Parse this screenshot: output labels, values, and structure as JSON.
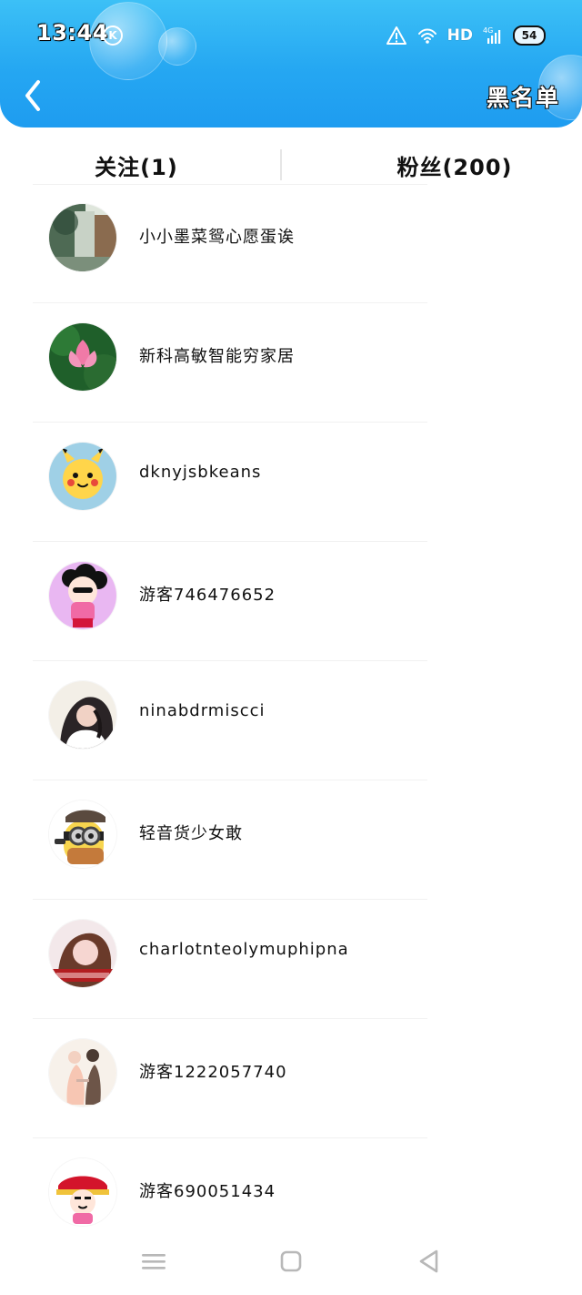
{
  "status_bar": {
    "time": "13:44",
    "carrier_icon": "k-icon",
    "right_icons": [
      "alert-icon",
      "wifi-icon",
      "hd-label",
      "signal-icon",
      "battery-pill"
    ],
    "hd": "HD",
    "battery": "54"
  },
  "header": {
    "back_icon": "chevron-left-icon",
    "blacklist_label": "黑名单"
  },
  "tabs": {
    "follow_label": "关注(1)",
    "fans_label": "粉丝(200)"
  },
  "list": {
    "items": [
      {
        "name": "小小墨菜鸳心愿蛋诶",
        "avatar_icon": "avatar-landscape"
      },
      {
        "name": "新科高敏智能穷家居",
        "avatar_icon": "avatar-lotus"
      },
      {
        "name": "dknyjsbkeans",
        "avatar_icon": "avatar-pikachu"
      },
      {
        "name": "游客746476652",
        "avatar_icon": "avatar-cartoon-girl"
      },
      {
        "name": "ninabdrmiscci",
        "avatar_icon": "avatar-portrait"
      },
      {
        "name": "轻音货少女敢",
        "avatar_icon": "avatar-minion"
      },
      {
        "name": "charlotnteolymuphipna",
        "avatar_icon": "avatar-girl-banner"
      },
      {
        "name": "游客1222057740",
        "avatar_icon": "avatar-couple"
      },
      {
        "name": "游客690051434",
        "avatar_icon": "avatar-cartoon-hat"
      }
    ]
  },
  "bottom_nav": {
    "menu_icon": "menu-icon",
    "home_icon": "square-icon",
    "back_icon": "triangle-back-icon"
  },
  "colors": {
    "header_blue": "#25a7f2",
    "divider": "#f1f1f1"
  }
}
